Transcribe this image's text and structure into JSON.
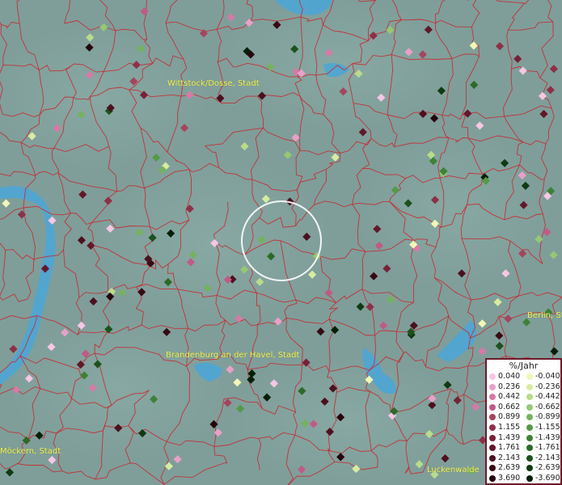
{
  "places": [
    {
      "label": "Wittstock/Dosse, Stadt",
      "id": "wittstock"
    },
    {
      "label": "Brandenburg an der Havel, Stadt",
      "id": "brandenburg"
    },
    {
      "label": "Berlin, St",
      "id": "berlin"
    },
    {
      "label": "Möckern, Stadt",
      "id": "moeckern"
    },
    {
      "label": "Luckenwalde",
      "id": "luckenwalde"
    }
  ],
  "legend": {
    "title": "%/Jahr",
    "positive": [
      {
        "label": "0.040",
        "color": "#f7c6e4"
      },
      {
        "label": "0.236",
        "color": "#e8a0c8"
      },
      {
        "label": "0.442",
        "color": "#d67aa6"
      },
      {
        "label": "0.662",
        "color": "#c05a86"
      },
      {
        "label": "0.899",
        "color": "#a5445e"
      },
      {
        "label": "1.155",
        "color": "#8e3048"
      },
      {
        "label": "1.439",
        "color": "#762238"
      },
      {
        "label": "1.761",
        "color": "#62182a"
      },
      {
        "label": "2.143",
        "color": "#4c101e"
      },
      {
        "label": "2.639",
        "color": "#380a14"
      },
      {
        "label": "3.690",
        "color": "#24050b"
      }
    ],
    "negative": [
      {
        "label": "-0.040",
        "color": "#f2f7b4"
      },
      {
        "label": "-0.236",
        "color": "#d7eca0"
      },
      {
        "label": "-0.442",
        "color": "#b9dc8a"
      },
      {
        "label": "-0.662",
        "color": "#96c874"
      },
      {
        "label": "-0.899",
        "color": "#74b25e"
      },
      {
        "label": "-1.155",
        "color": "#559a48"
      },
      {
        "label": "-1.439",
        "color": "#3e8236"
      },
      {
        "label": "-1.761",
        "color": "#2c6a28"
      },
      {
        "label": "-2.143",
        "color": "#1c521c"
      },
      {
        "label": "-2.639",
        "color": "#0f3a12"
      },
      {
        "label": "-3.690",
        "color": "#052008"
      }
    ]
  },
  "colors": {
    "water": "#4aa6d8",
    "boundary": "#c8282e",
    "label": "#f2f25a",
    "legend_border": "#6a1a2a"
  }
}
